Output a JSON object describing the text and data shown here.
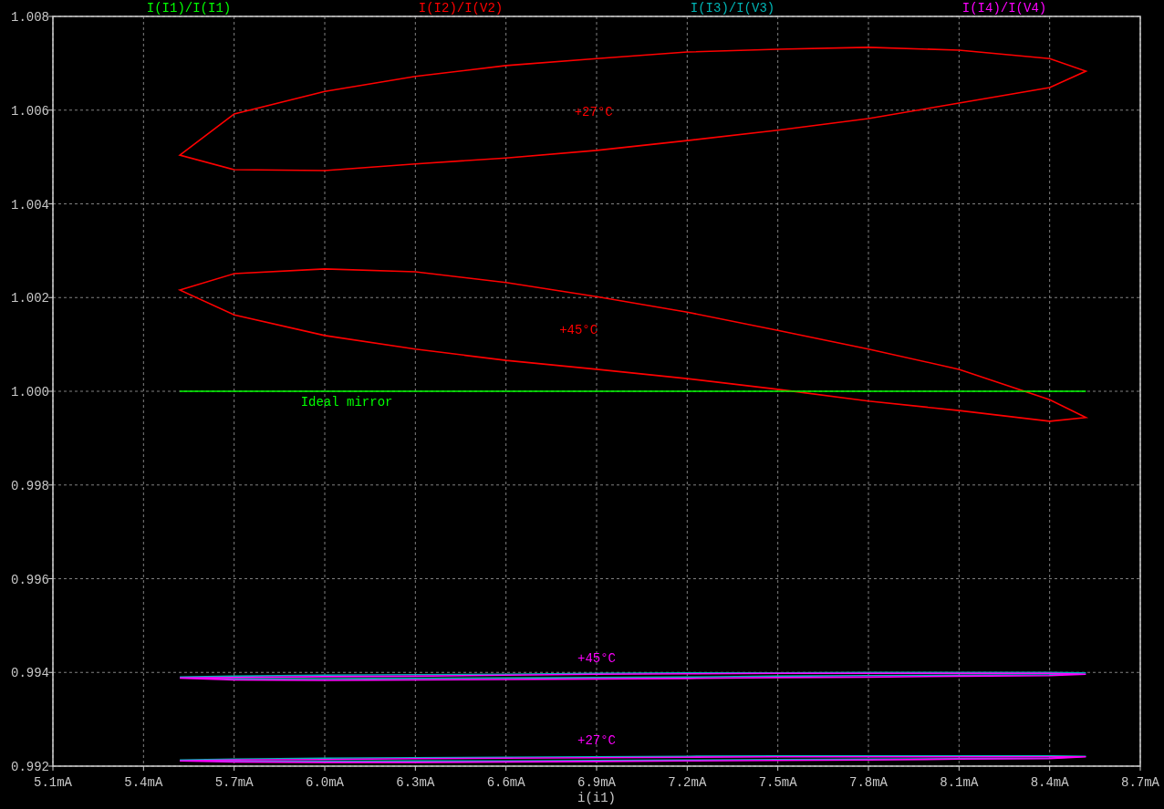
{
  "plot": {
    "legend": [
      {
        "label": "I(I1)/I(I1)",
        "color": "#00ff00"
      },
      {
        "label": "I(I2)/I(V2)",
        "color": "#ff0000"
      },
      {
        "label": "I(I3)/I(V3)",
        "color": "#00b4b4"
      },
      {
        "label": "I(I4)/I(V4)",
        "color": "#ff00ff"
      }
    ],
    "chart_data": {
      "type": "line",
      "xlabel": "i(i1)",
      "grid": true,
      "x": [
        5.52,
        8.52
      ],
      "series": [
        {
          "name": "Ideal mirror",
          "color": "#00ff00",
          "values": [
            1.0,
            1.0
          ]
        }
      ],
      "xlim": [
        5.1,
        8.7
      ],
      "ylim": [
        0.992,
        1.008
      ],
      "xticks": [
        {
          "value": 5.1,
          "label": "5.1mA"
        },
        {
          "value": 5.4,
          "label": "5.4mA"
        },
        {
          "value": 5.7,
          "label": "5.7mA"
        },
        {
          "value": 6.0,
          "label": "6.0mA"
        },
        {
          "value": 6.3,
          "label": "6.3mA"
        },
        {
          "value": 6.6,
          "label": "6.6mA"
        },
        {
          "value": 6.9,
          "label": "6.9mA"
        },
        {
          "value": 7.2,
          "label": "7.2mA"
        },
        {
          "value": 7.5,
          "label": "7.5mA"
        },
        {
          "value": 7.8,
          "label": "7.8mA"
        },
        {
          "value": 8.1,
          "label": "8.1mA"
        },
        {
          "value": 8.4,
          "label": "8.4mA"
        },
        {
          "value": 8.7,
          "label": "8.7mA"
        }
      ],
      "yticks": [
        {
          "value": 0.992,
          "label": "0.992"
        },
        {
          "value": 0.994,
          "label": "0.994"
        },
        {
          "value": 0.996,
          "label": "0.996"
        },
        {
          "value": 0.998,
          "label": "0.998"
        },
        {
          "value": 1.0,
          "label": "1.000"
        },
        {
          "value": 1.002,
          "label": "1.002"
        },
        {
          "value": 1.004,
          "label": "1.004"
        },
        {
          "value": 1.006,
          "label": "1.006"
        },
        {
          "value": 1.008,
          "label": "1.008"
        }
      ]
    },
    "loops": [
      {
        "label": "+27°C",
        "traces": [
          {
            "color": "#ff0000"
          }
        ]
      },
      {
        "label": "+45°C",
        "traces": [
          {
            "color": "#ff0000"
          }
        ]
      },
      {
        "label": "+45°C",
        "traces": [
          {
            "color": "#00b4b4"
          },
          {
            "color": "#ff00ff"
          }
        ]
      },
      {
        "label": "+27°C",
        "traces": [
          {
            "color": "#00b4b4"
          },
          {
            "color": "#ff00ff"
          }
        ]
      }
    ]
  }
}
